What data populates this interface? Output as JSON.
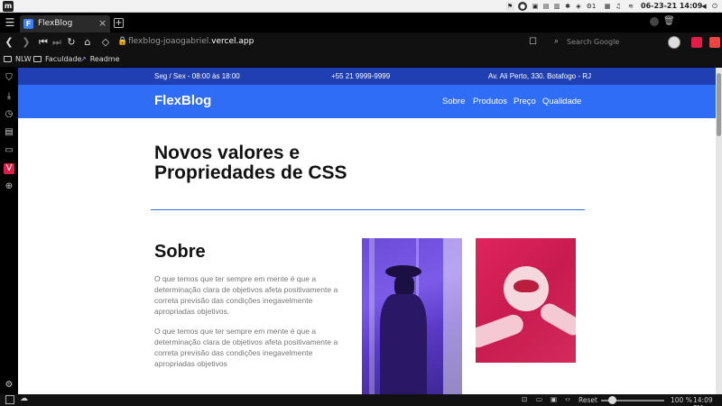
{
  "os": {
    "clock": "06-23-21 14:09",
    "tray_update": "1"
  },
  "browser": {
    "tab": {
      "title": "FlexBlog",
      "favicon": "F"
    },
    "url": {
      "prefix": "flexblog-joaogabriel.",
      "domain": "vercel.app"
    },
    "search_placeholder": "Search Google",
    "bookmarks": [
      "NLW",
      "Faculdade",
      "Readme"
    ],
    "status": {
      "reset_label": "Reset",
      "zoom": "100 %",
      "clock": "14:09 PM"
    }
  },
  "site": {
    "top_strip": {
      "hours": "Seg / Sex - 08:00 às 18:00",
      "phone": "+55 21 9999-9999",
      "address": "Av. Ali Perto, 330. Botafogo - RJ"
    },
    "logo": "FlexBlog",
    "nav": [
      "Sobre",
      "Produtos",
      "Preço",
      "Qualidade"
    ],
    "hero_title_line1": "Novos valores e",
    "hero_title_line2": "Propriedades de CSS",
    "about": {
      "heading": "Sobre",
      "paragraph1": "O que temos que ter sempre em mente é que a determinação clara de objetivos afeta positivamente a correta previsão das condições inegavelmente apropriadas objetivos.",
      "paragraph2": "O que temos que ter sempre em mente é que a determinação clara de objetivos afeta positivamente a correta previsão das condições inegavelmente apropriadas objetivos"
    }
  }
}
